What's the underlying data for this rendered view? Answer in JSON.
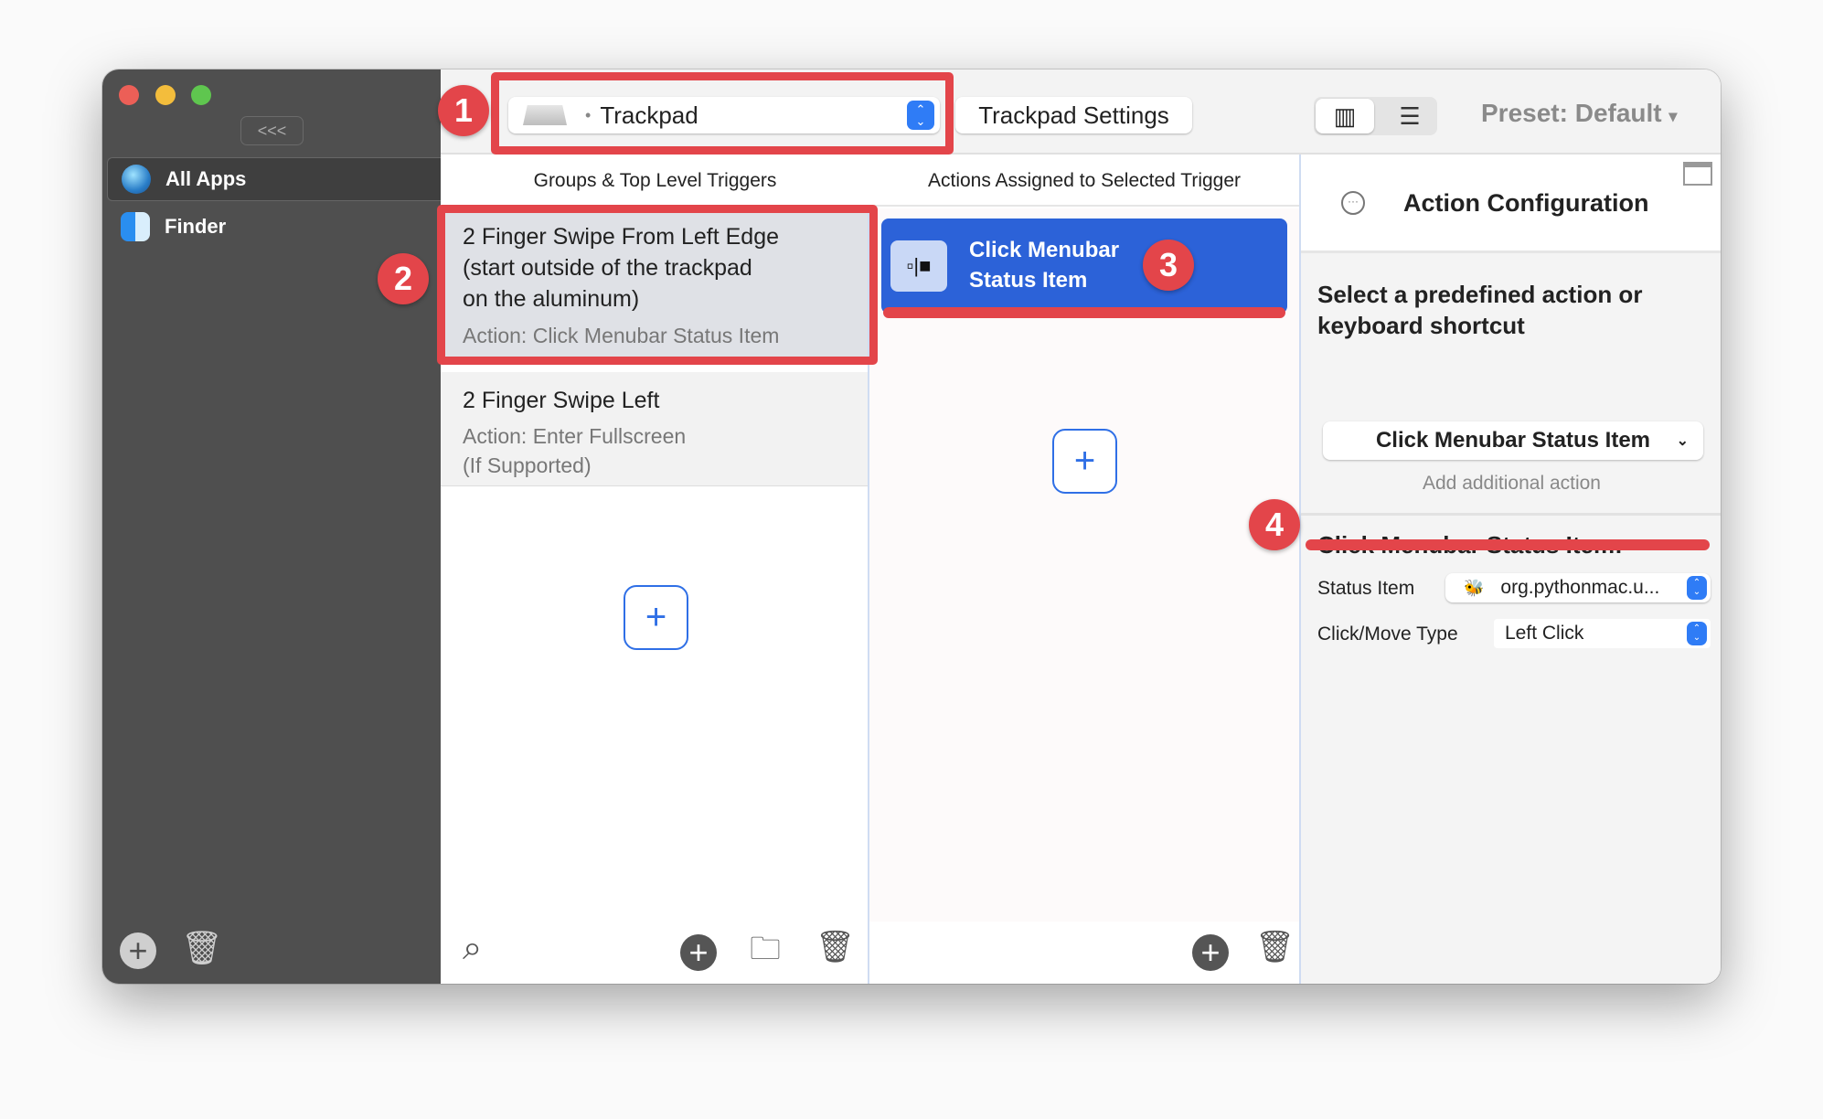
{
  "sidebar": {
    "collapse_label": "<<<",
    "items": [
      {
        "label": "All Apps",
        "icon": "globe-icon",
        "selected": true
      },
      {
        "label": "Finder",
        "icon": "finder-icon",
        "selected": false
      }
    ]
  },
  "toolbar": {
    "device": "Trackpad",
    "device_bullet": "•",
    "settings_button": "Trackpad Settings",
    "preset": "Preset: Default",
    "preset_caret": "▾"
  },
  "columns": {
    "triggers_header": "Groups & Top Level Triggers",
    "actions_header": "Actions Assigned to Selected Trigger"
  },
  "triggers": [
    {
      "title_lines": [
        "2 Finger Swipe From Left Edge",
        "(start outside of the trackpad",
        "on the aluminum)"
      ],
      "action": "Action: Click Menubar Status Item",
      "selected": true
    },
    {
      "title_lines": [
        "2 Finger Swipe Left"
      ],
      "action_lines": [
        "Action: Enter Fullscreen",
        "(If Supported)"
      ],
      "selected": false
    }
  ],
  "actions": [
    {
      "label_lines": [
        "Click Menubar",
        "Status Item"
      ],
      "selected": true
    }
  ],
  "config": {
    "title": "Action Configuration",
    "select_label_lines": [
      "Select a predefined action or",
      "keyboard shortcut"
    ],
    "selected_action": "Click Menubar Status Item",
    "add_additional": "Add additional action",
    "section_title": "Click Menubar Status Item:",
    "status_item_label": "Status Item",
    "status_item_value": "org.pythonmac.u...",
    "click_type_label": "Click/Move Type",
    "click_type_value": "Left Click"
  },
  "annotations": [
    "1",
    "2",
    "3",
    "4"
  ],
  "colors": {
    "accent": "#2f6fe6",
    "annotation": "#e3454a",
    "sidebar": "#4f4f4f"
  }
}
